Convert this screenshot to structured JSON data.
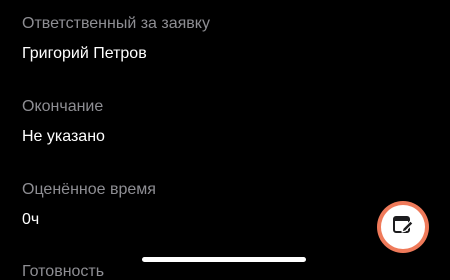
{
  "fields": [
    {
      "label": "Ответственный за заявку",
      "value": "Григорий Петров"
    },
    {
      "label": "Окончание",
      "value": "Не указано"
    },
    {
      "label": "Оценённое время",
      "value": "0ч"
    },
    {
      "label": "Готовность"
    }
  ],
  "edit_fab": {
    "icon": "edit-note-icon",
    "accent_color": "#ef7a5a"
  },
  "colors": {
    "background": "#000000",
    "label": "#8e8e93",
    "value": "#ffffff"
  }
}
